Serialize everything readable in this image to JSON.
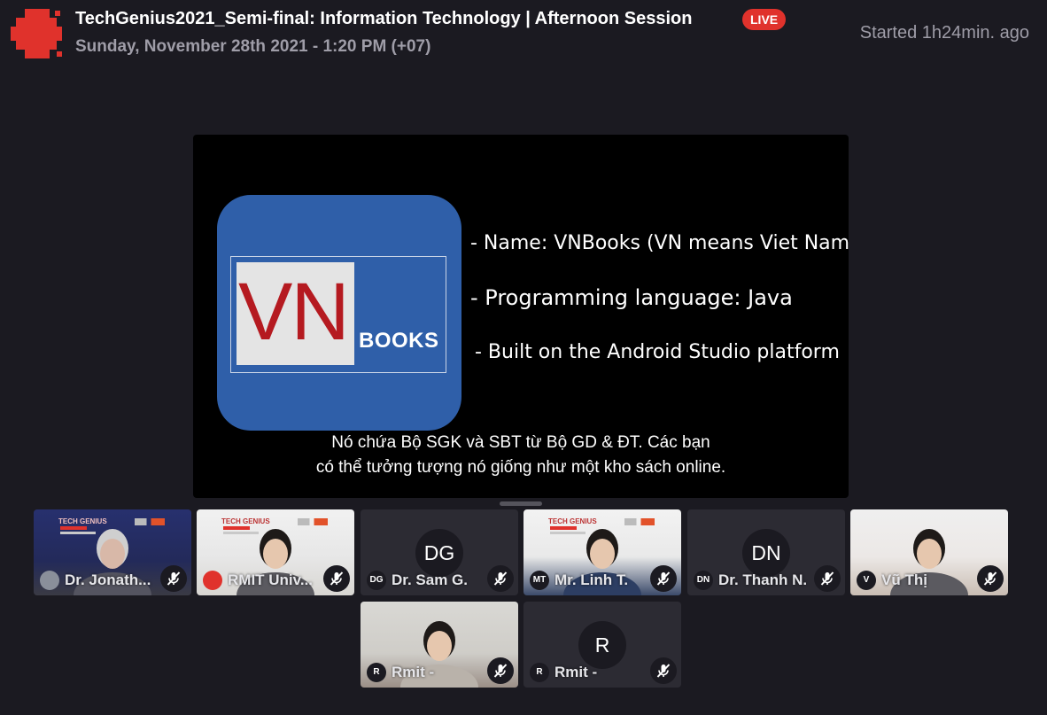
{
  "header": {
    "title": "TechGenius2021_Semi-final: Information Technology | Afternoon Session",
    "live_label": "LIVE",
    "date": "Sunday, November 28th 2021 - 1:20 PM (+07)",
    "started": "Started 1h24min. ago"
  },
  "colors": {
    "background": "#1b1a21",
    "live": "#e0322c",
    "muted_text": "#9f9da8",
    "tile": "#2c2b33",
    "slide_logo_blue": "#2f5fa9",
    "slide_logo_red": "#b51a20"
  },
  "slide": {
    "logo_main": "VN",
    "logo_sub": "BOOKS",
    "bullets": [
      "- Name: VNBooks (VN means Viet Nam)",
      "- Programming language: Java",
      "- Built on the Android Studio platform"
    ],
    "caption_lines": [
      "Nó chứa Bộ SGK và SBT từ Bộ GD & ĐT. Các bạn",
      "có thể tưởng tượng nó giống như một kho sách online."
    ]
  },
  "participants": [
    {
      "initials": "",
      "name": "Dr. Jonath...",
      "video": true,
      "muted": true,
      "banner_brand": "TECH GENIUS"
    },
    {
      "initials": "",
      "name": "RMIT Univ...",
      "video": true,
      "muted": true,
      "banner_brand": "TECH GENIUS"
    },
    {
      "initials": "DG",
      "name": "Dr. Sam G.",
      "video": false,
      "muted": true
    },
    {
      "initials": "MT",
      "name": "Mr. Linh T.",
      "video": true,
      "muted": true,
      "banner_brand": "TECH GENIUS"
    },
    {
      "initials": "DN",
      "name": "Dr. Thanh N.",
      "video": false,
      "muted": true
    },
    {
      "initials": "V",
      "name": "Vũ Thị",
      "video": true,
      "muted": true
    },
    {
      "initials": "R",
      "name": "Rmit -",
      "video": true,
      "muted": true
    },
    {
      "initials": "R",
      "name": "Rmit -",
      "video": false,
      "muted": true
    }
  ]
}
